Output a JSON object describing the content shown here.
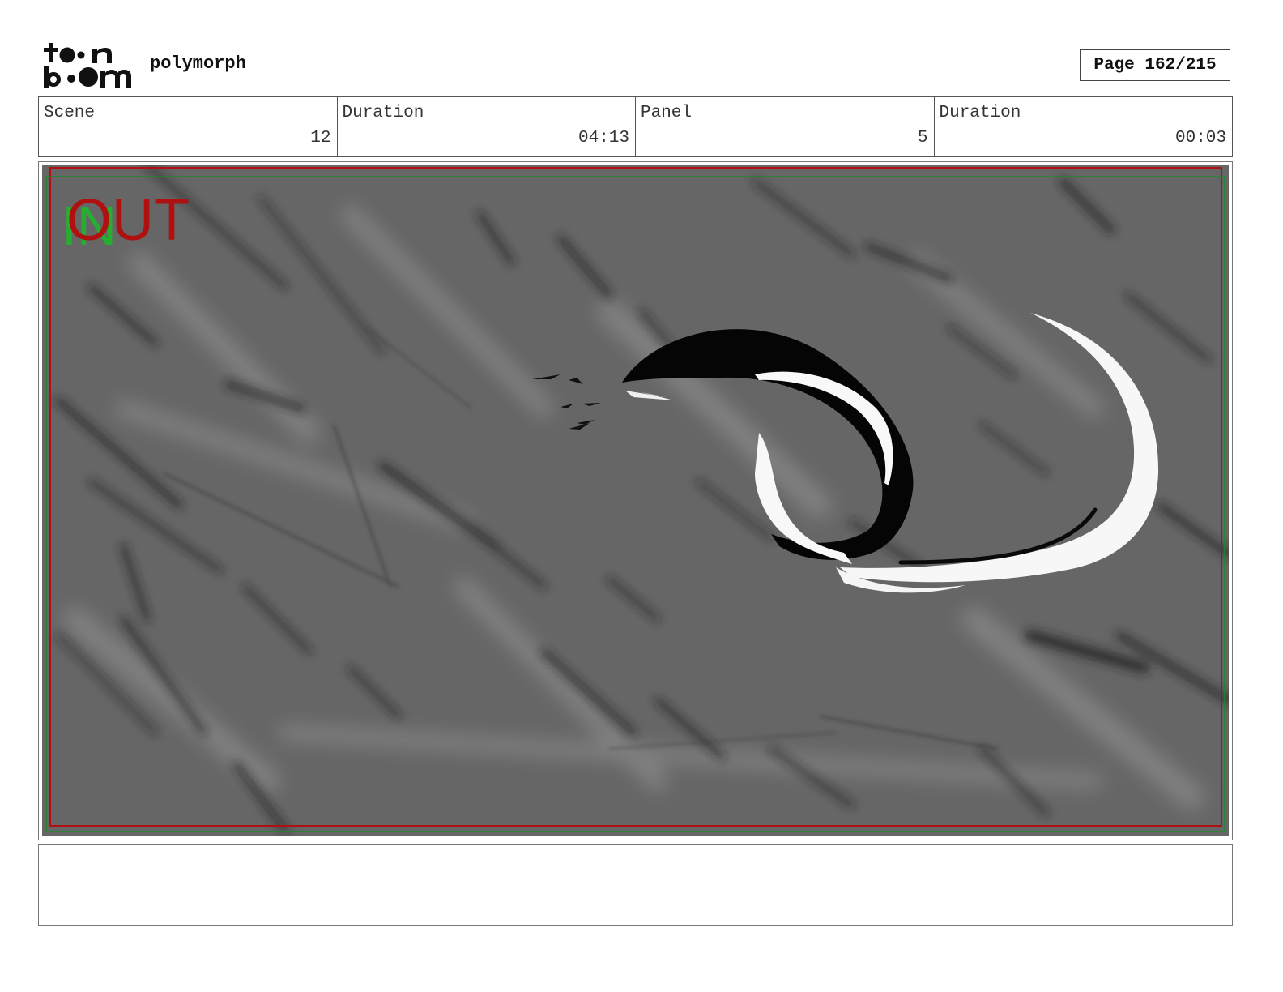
{
  "header": {
    "logo_text": "toon boom",
    "project_name": "polymorph",
    "page_label": "Page 162/215"
  },
  "info": {
    "scene_label": "Scene",
    "scene_value": "12",
    "scene_duration_label": "Duration",
    "scene_duration_value": "04:13",
    "panel_label": "Panel",
    "panel_value": "5",
    "panel_duration_label": "Duration",
    "panel_duration_value": "00:03"
  },
  "panel": {
    "in_marker": "IN",
    "out_marker": "OUT",
    "background_color": "#666666",
    "safe_frame_red": "#b01010",
    "safe_frame_green": "#1a8a2a"
  },
  "notes": {
    "text": ""
  }
}
